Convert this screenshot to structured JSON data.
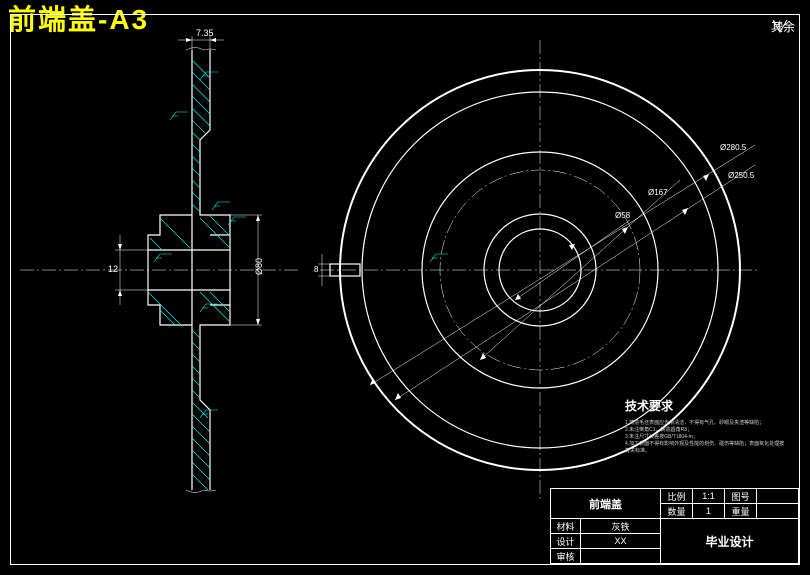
{
  "title": "前端盖-A3",
  "corner_note": "其余",
  "dimensions": {
    "thick1": "7.35",
    "thick2": "12",
    "d80": "Ø80",
    "d58": "Ø58",
    "d167": "Ø167",
    "d250": "Ø250.5",
    "d280": "Ø280.5",
    "d8": "8"
  },
  "tech_req": {
    "header": "技术要求",
    "body": "1.铸造毛坯表面应光滑清洁，不得有气孔、砂眼及夹渣等缺陷；\n2.未注倒角C1，铸造圆角R3；\n3.未注尺寸公差按GB/T1804-m；\n4.加工表面不得有影响外观及性能的划伤、碰伤等缺陷；表面氧化处理按有关标准。"
  },
  "title_block": {
    "part_name": "前端盖",
    "scale_lbl": "比例",
    "scale_val": "1:1",
    "sheet_lbl": "图号",
    "sheet_val": "",
    "qty_lbl": "数量",
    "qty_val": "1",
    "mass_lbl": "重量",
    "mass_val": "",
    "material_lbl": "材料",
    "material_val": "灰铁",
    "design_lbl": "设计",
    "design_val": "XX",
    "check_lbl": "审核",
    "check_val": "",
    "project": "毕业设计"
  }
}
